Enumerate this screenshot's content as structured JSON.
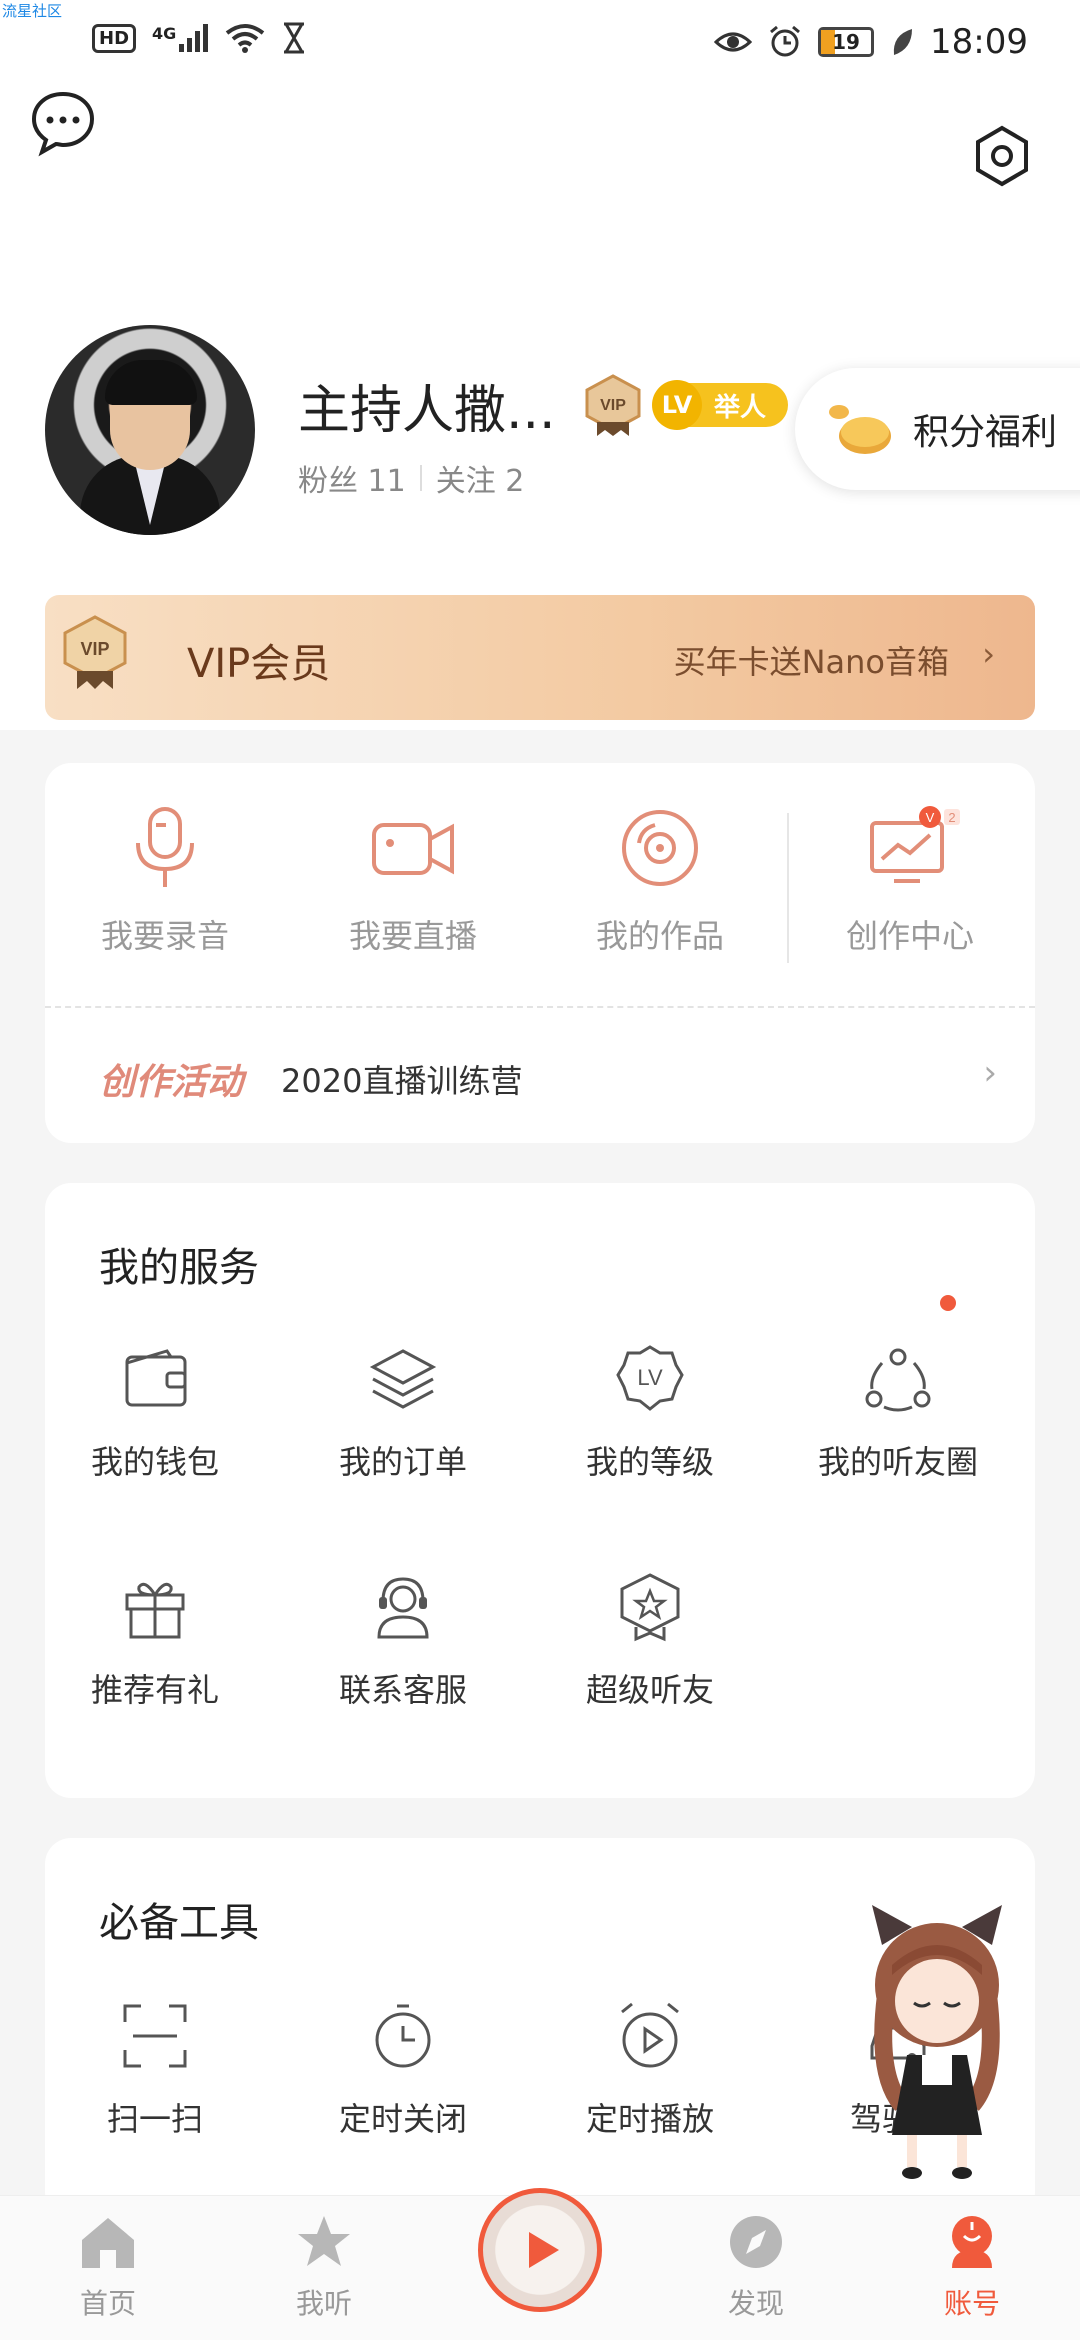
{
  "watermark": "流星社区",
  "status_bar": {
    "hd": "HD",
    "signal": "4G",
    "battery": "19",
    "time": "18:09"
  },
  "profile": {
    "name": "主持人撒...",
    "fans": "粉丝 11",
    "follow": "关注 2",
    "vip_badge": "VIP",
    "level": "LV",
    "level_title": "举人",
    "points_label": "积分福利"
  },
  "vip_banner": {
    "badge": "VIP",
    "title": "VIP会员",
    "promo": "买年卡送Nano音箱",
    "chevron": "›"
  },
  "create": {
    "items": [
      {
        "label": "我要录音",
        "icon": "microphone-icon"
      },
      {
        "label": "我要直播",
        "icon": "video-camera-icon"
      },
      {
        "label": "我的作品",
        "icon": "disc-icon"
      },
      {
        "label": "创作中心",
        "icon": "chart-monitor-icon",
        "badge": "2"
      }
    ],
    "activity_tag": "创作活动",
    "activity_name": "2020直播训练营"
  },
  "services": {
    "title": "我的服务",
    "items": [
      {
        "label": "我的钱包",
        "icon": "wallet-icon"
      },
      {
        "label": "我的订单",
        "icon": "layers-icon"
      },
      {
        "label": "我的等级",
        "icon": "level-icon",
        "icon_text": "LV"
      },
      {
        "label": "我的听友圈",
        "icon": "circle-friends-icon"
      },
      {
        "label": "推荐有礼",
        "icon": "gift-icon"
      },
      {
        "label": "联系客服",
        "icon": "headset-icon"
      },
      {
        "label": "超级听友",
        "icon": "star-badge-icon"
      }
    ]
  },
  "tools": {
    "title": "必备工具",
    "items": [
      {
        "label": "扫一扫",
        "icon": "scan-icon"
      },
      {
        "label": "定时关闭",
        "icon": "timer-icon"
      },
      {
        "label": "定时播放",
        "icon": "alarm-play-icon"
      },
      {
        "label": "驾驶模",
        "icon": "car-icon"
      }
    ]
  },
  "tabs": [
    {
      "label": "首页",
      "icon": "home-icon"
    },
    {
      "label": "我听",
      "icon": "star-icon"
    },
    {
      "label": "发现",
      "icon": "compass-icon"
    },
    {
      "label": "账号",
      "icon": "account-icon"
    }
  ],
  "colors": {
    "accent": "#f05a3c",
    "vip_gold": "#c9904e",
    "level_yellow": "#f6c21e"
  }
}
